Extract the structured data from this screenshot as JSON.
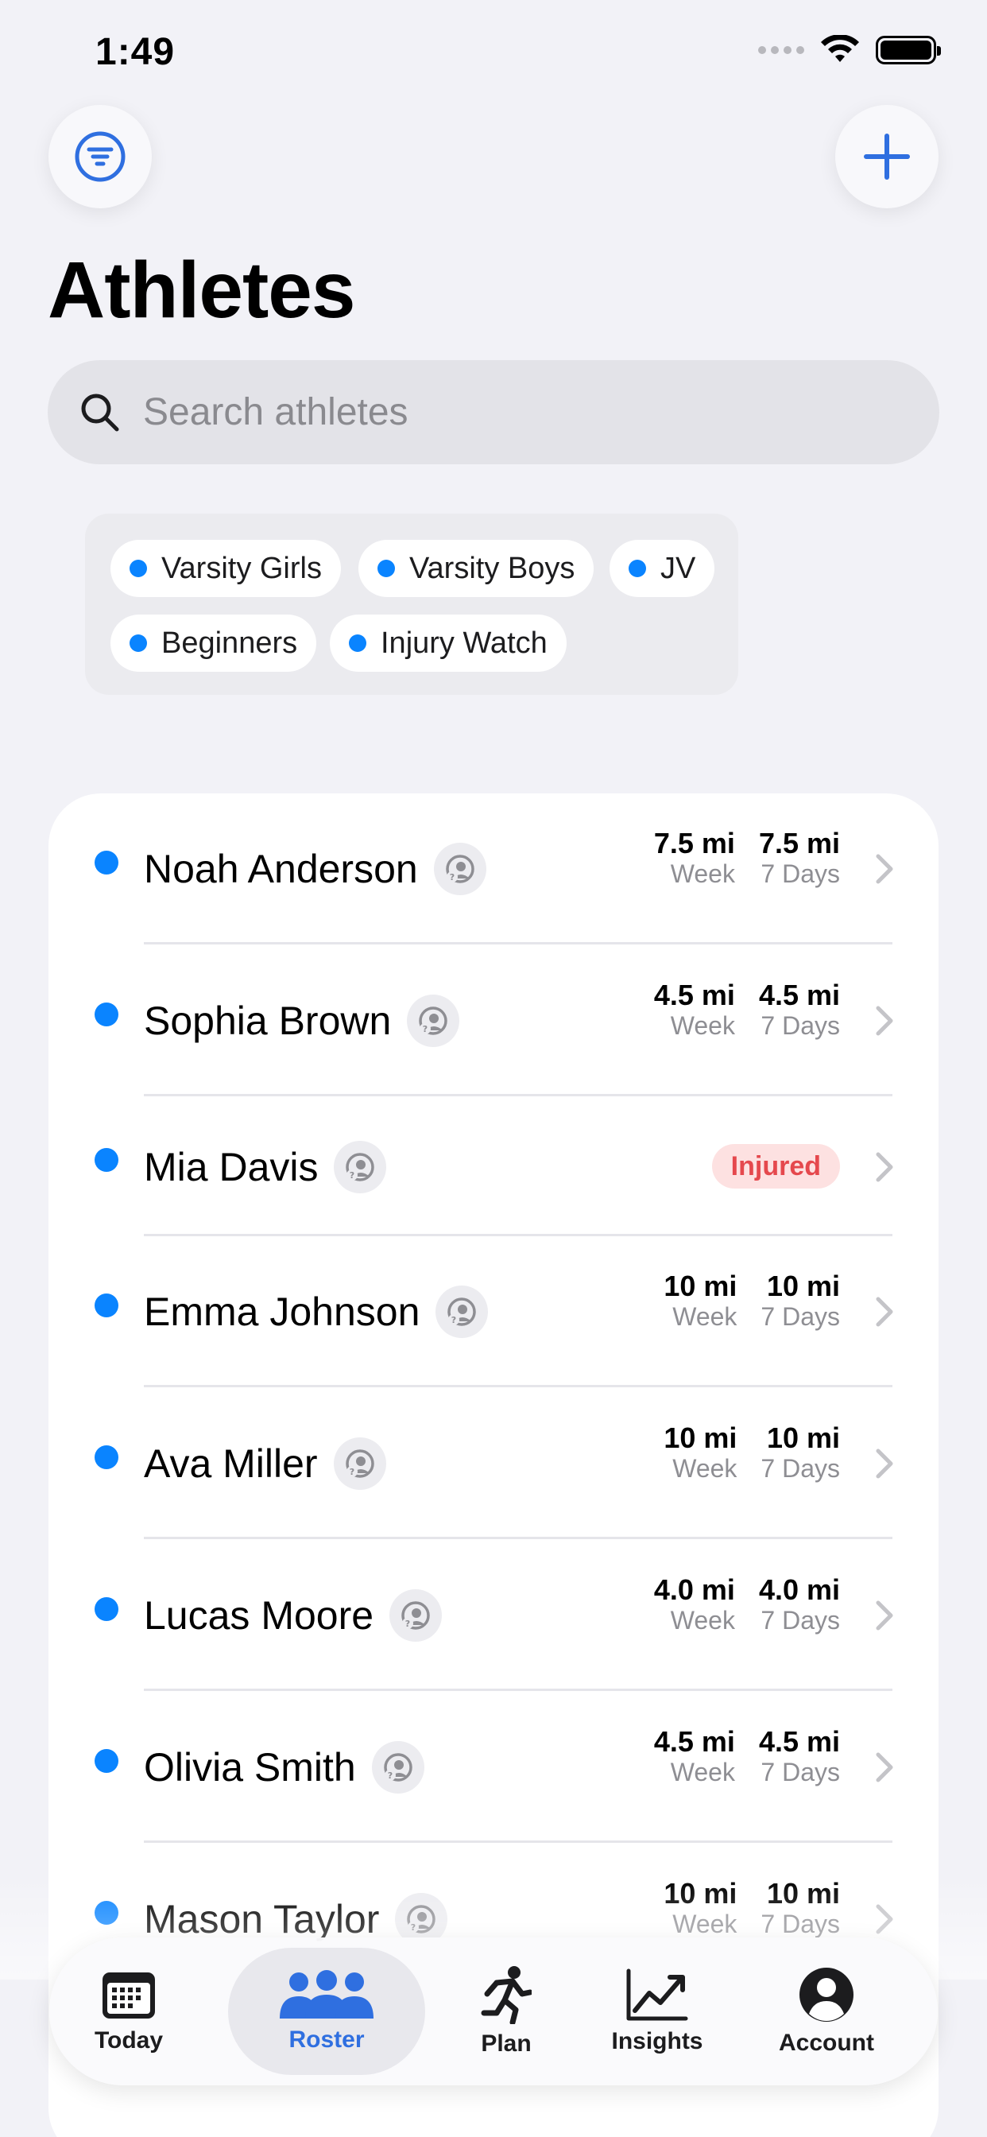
{
  "status_bar": {
    "time": "1:49"
  },
  "page": {
    "title": "Athletes"
  },
  "search": {
    "placeholder": "Search athletes"
  },
  "groups": [
    "Varsity Girls",
    "Varsity Boys",
    "JV",
    "Beginners",
    "Injury Watch"
  ],
  "colors": {
    "accent": "#0a84ff",
    "injured_bg": "#fde1e1",
    "injured_text": "#e5484d",
    "tab_active": "#2f6fe0"
  },
  "athletes": [
    {
      "name": "Noah Anderson",
      "week": "7.5 mi",
      "week_label": "Week",
      "seven": "7.5 mi",
      "seven_label": "7 Days"
    },
    {
      "name": "Sophia Brown",
      "week": "4.5 mi",
      "week_label": "Week",
      "seven": "4.5 mi",
      "seven_label": "7 Days"
    },
    {
      "name": "Mia Davis",
      "status": "Injured"
    },
    {
      "name": "Emma Johnson",
      "week": "10 mi",
      "week_label": "Week",
      "seven": "10 mi",
      "seven_label": "7 Days"
    },
    {
      "name": "Ava Miller",
      "week": "10 mi",
      "week_label": "Week",
      "seven": "10 mi",
      "seven_label": "7 Days"
    },
    {
      "name": "Lucas Moore",
      "week": "4.0 mi",
      "week_label": "Week",
      "seven": "4.0 mi",
      "seven_label": "7 Days"
    },
    {
      "name": "Olivia Smith",
      "week": "4.5 mi",
      "week_label": "Week",
      "seven": "4.5 mi",
      "seven_label": "7 Days"
    },
    {
      "name": "Mason Taylor",
      "week": "10 mi",
      "week_label": "Week",
      "seven": "10 mi",
      "seven_label": "7 Days"
    }
  ],
  "tabs": [
    {
      "label": "Today",
      "icon": "calendar-icon"
    },
    {
      "label": "Roster",
      "icon": "people-icon",
      "active": true
    },
    {
      "label": "Plan",
      "icon": "runner-icon"
    },
    {
      "label": "Insights",
      "icon": "chart-icon"
    },
    {
      "label": "Account",
      "icon": "person-circle-icon"
    }
  ]
}
